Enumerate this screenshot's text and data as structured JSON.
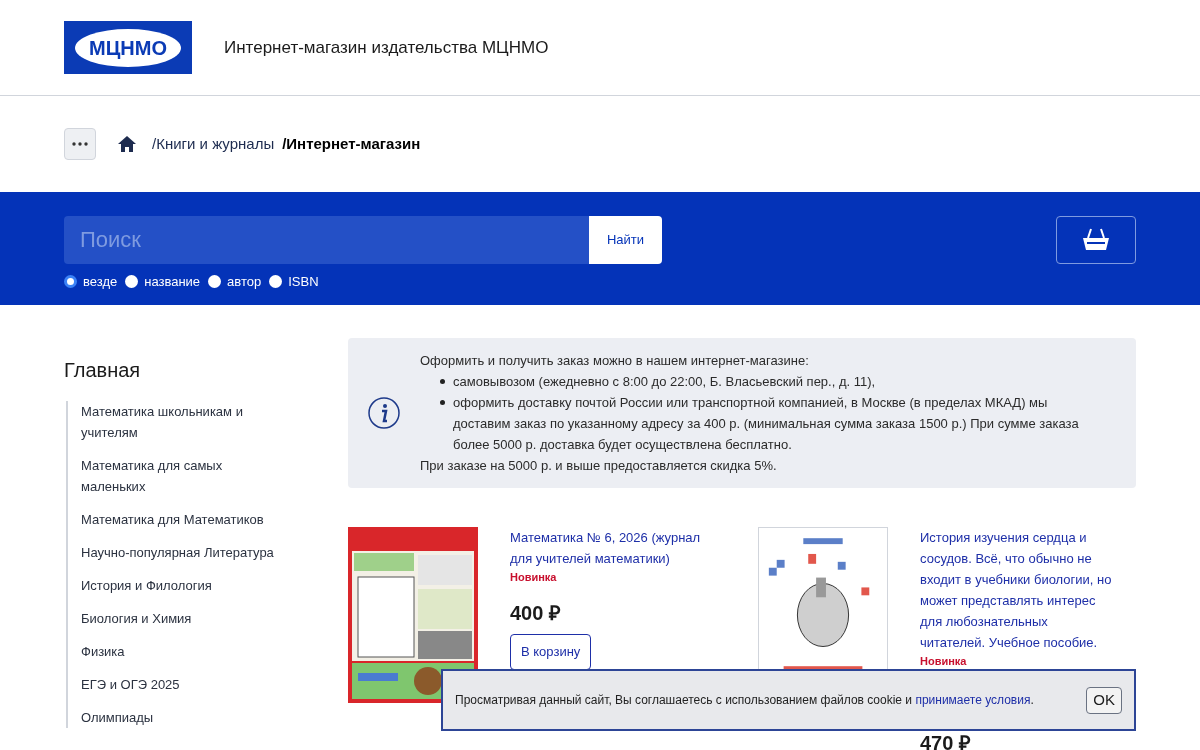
{
  "header": {
    "logo": "МЦНМО",
    "title": "Интернет-магазин издательства МЦНМО"
  },
  "breadcrumbs": [
    {
      "label": "/Книги и журналы",
      "current": false
    },
    {
      "label": "/Интернет-магазин",
      "current": true
    }
  ],
  "search": {
    "placeholder": "Поиск",
    "button": "Найти",
    "scopes": [
      {
        "label": "везде",
        "selected": true
      },
      {
        "label": "название",
        "selected": false
      },
      {
        "label": "автор",
        "selected": false
      },
      {
        "label": "ISBN",
        "selected": false
      }
    ]
  },
  "sidebar": {
    "title": "Главная",
    "items": [
      "Математика школьникам и учителям",
      "Математика для самых маленьких",
      "Математика для Математиков",
      "Научно-популярная Литература",
      "История и Филология",
      "Биология и Химия",
      "Физика",
      "ЕГЭ и ОГЭ 2025",
      "Олимпиады"
    ]
  },
  "info": {
    "intro": "Оформить и получить заказ можно в нашем интернет-магазине:",
    "bullets": [
      "самовывозом (ежедневно с 8:00 до 22:00, Б. Власьевский пер., д. 11),",
      "оформить доставку почтой России или транспортной компанией, в Москве (в пределах МКАД) мы доставим заказ по указанному адресу за 400 р. (минимальная сумма заказа 1500 р.) При сумме заказа более 5000 р. доставка будет осуществлена бесплатно."
    ],
    "outro": "При заказе на 5000 р. и выше предоставляется скидка 5%."
  },
  "products": [
    {
      "title": "Математика № 6, 2026 (журнал для учителей математики)",
      "badge": "Новинка",
      "price": "400 ₽",
      "button": "В корзину"
    },
    {
      "title": "История изучения сердца и сосудов. Всё, что обычно не входит в учебники биологии, но может представлять интерес для любознательных читателей. Учебное пособие.",
      "badge": "Новинка",
      "price": "470 ₽"
    }
  ],
  "cookie_banner": {
    "text": "Просматривая данный сайт, Вы соглашаетесь с использованием файлов cookie и ",
    "link": "принимаете условия",
    "end": ".",
    "button": "OK"
  }
}
